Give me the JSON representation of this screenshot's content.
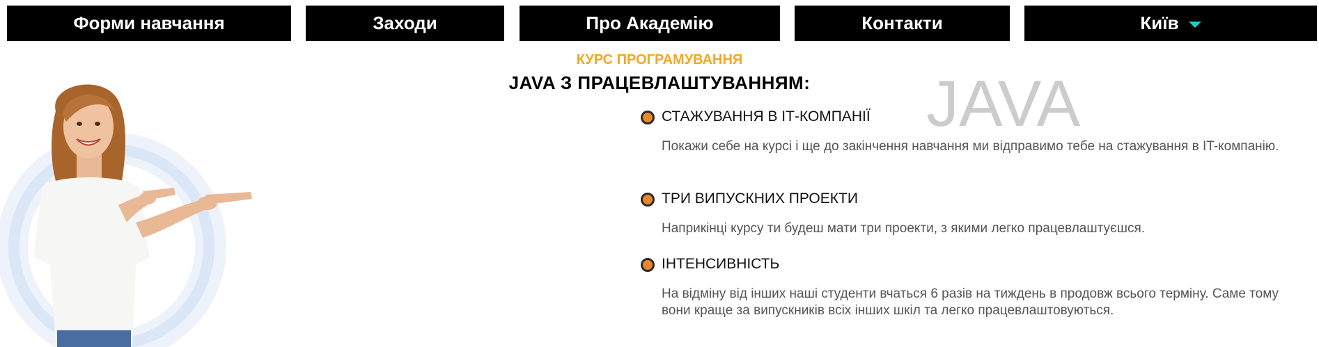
{
  "nav": {
    "items": [
      {
        "label": "Форми навчання"
      },
      {
        "label": "Заходи"
      },
      {
        "label": "Про Академію"
      },
      {
        "label": "Контакти"
      },
      {
        "label": "Київ",
        "icon": "caret-down-icon"
      }
    ]
  },
  "hero": {
    "kicker": "КУРС ПРОГРАМУВАННЯ",
    "title": "JAVA З ПРАЦЕВЛАШТУВАННЯМ:",
    "watermark": "JAVA"
  },
  "features": [
    {
      "title": "СТАЖУВАННЯ В ІТ-КОМПАНІЇ",
      "text": "Покажи себе на курсі і ще до закінчення навчання ми відправимо тебе на стажування в IT-компанію."
    },
    {
      "title": "ТРИ ВИПУСКНИХ ПРОЕКТИ",
      "text": "Наприкінці курсу ти будеш мати три проекти, з якими легко працевлаштуєшся."
    },
    {
      "title": "ІНТЕНСИВНІСТЬ",
      "text": "На відміну від інших наші студенти вчаться 6 разів на тиждень в продовж всього терміну. Саме тому вони краще за випускників всіх інших шкіл та легко працевлаштовуються."
    }
  ],
  "colors": {
    "nav_bg": "#000000",
    "nav_text": "#ffffff",
    "caret": "#1ccfc9",
    "kicker": "#f5a623",
    "bullet": "#e8872b",
    "watermark": "#cccccc"
  }
}
